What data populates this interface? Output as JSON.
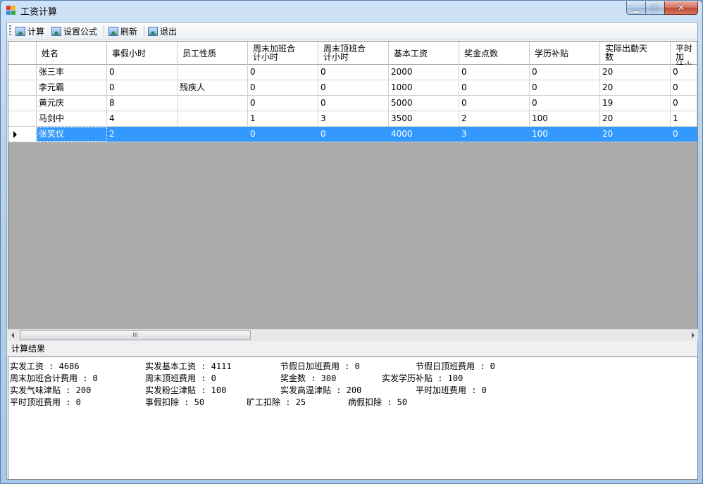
{
  "window": {
    "title": "工资计算",
    "min": "▁",
    "max": "□",
    "close": "✕"
  },
  "toolbar": {
    "calc_label": "计算",
    "formula_label": "设置公式",
    "refresh_label": "刷新",
    "exit_label": "退出"
  },
  "grid": {
    "columns": [
      "姓名",
      "事假小时",
      "员工性质",
      "周末加班合\n计小时",
      "周末顶班合\n计小时",
      "基本工资",
      "奖金点数",
      "学历补贴",
      "实际出勤天\n数",
      "平时加\n计小时"
    ],
    "rows": [
      [
        "张三丰",
        "0",
        "",
        "0",
        "0",
        "2000",
        "0",
        "0",
        "20",
        "0"
      ],
      [
        "李元霸",
        "0",
        "残疾人",
        "0",
        "0",
        "1000",
        "0",
        "0",
        "20",
        "0"
      ],
      [
        "黄元庆",
        "8",
        "",
        "0",
        "0",
        "5000",
        "0",
        "0",
        "19",
        "0"
      ],
      [
        "马剑中",
        "4",
        "",
        "1",
        "3",
        "3500",
        "2",
        "100",
        "20",
        "1"
      ],
      [
        "张笑仪",
        "2",
        "",
        "0",
        "0",
        "4000",
        "3",
        "100",
        "20",
        "0"
      ]
    ],
    "selected_row": 4,
    "scroll_thumb": "III"
  },
  "results": {
    "label": "计算结果",
    "items": [
      "实发工资 : 4686",
      "实发基本工资 : 4111",
      "节假日加班费用 : 0",
      "节假日顶班费用 : 0",
      "周末加班合计费用 : 0",
      "周末顶班费用 : 0",
      "奖金数 : 300",
      "实发学历补贴 : 100",
      "实发气味津贴 : 200",
      "实发粉尘津贴 : 100",
      "实发高温津贴 : 200",
      "平时加班费用 : 0",
      "平时顶班费用 : 0",
      "事假扣除 : 50",
      "旷工扣除 : 25",
      "病假扣除 : 50"
    ]
  },
  "colors": {
    "selection": "#3399ff",
    "grid_background": "#ababab"
  }
}
